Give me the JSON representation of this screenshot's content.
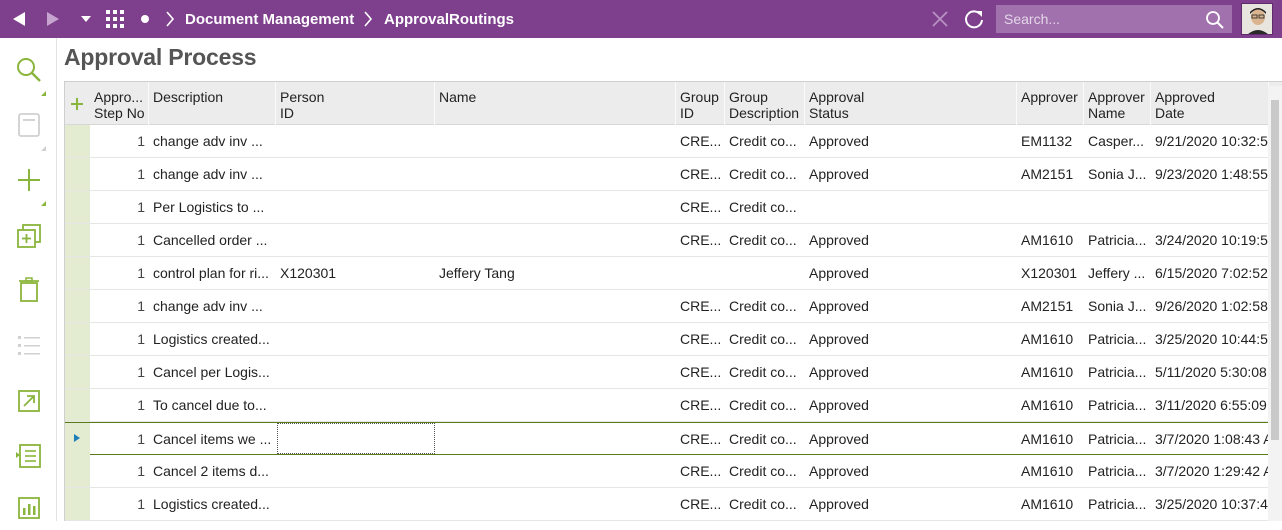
{
  "topbar": {
    "breadcrumbs": [
      "Document Management",
      "ApprovalRoutings"
    ],
    "search_placeholder": "Search...",
    "colors": {
      "bar": "#7e3f8d",
      "accent": "#8ab53c"
    }
  },
  "sidebar": {
    "icons": [
      "search-icon",
      "save-icon",
      "add-icon",
      "duplicate-icon",
      "delete-icon",
      "list-icon",
      "navigate-icon",
      "details-list-icon",
      "chart-icon"
    ]
  },
  "page": {
    "title": "Approval Process"
  },
  "grid": {
    "columns": [
      {
        "key": "step",
        "label_1": "Appro...",
        "label_2": "Step No"
      },
      {
        "key": "desc",
        "label_1": "Description",
        "label_2": ""
      },
      {
        "key": "person",
        "label_1": "Person",
        "label_2": "ID"
      },
      {
        "key": "name",
        "label_1": "Name",
        "label_2": ""
      },
      {
        "key": "group",
        "label_1": "Group",
        "label_2": "ID"
      },
      {
        "key": "gdesc",
        "label_1": "Group",
        "label_2": "Description"
      },
      {
        "key": "status",
        "label_1": "Approval",
        "label_2": "Status"
      },
      {
        "key": "approver",
        "label_1": "Approver",
        "label_2": ""
      },
      {
        "key": "aname",
        "label_1": "Approver",
        "label_2": "Name"
      },
      {
        "key": "adate",
        "label_1": "Approved",
        "label_2": "Date"
      }
    ],
    "rows": [
      {
        "step": "1",
        "desc": "change adv inv ...",
        "person": "",
        "name": "",
        "group": "CRE...",
        "gdesc": "Credit co...",
        "status": "Approved",
        "approver": "EM1132",
        "aname": "Casper...",
        "adate": "9/21/2020 10:32:5"
      },
      {
        "step": "1",
        "desc": "change adv inv ...",
        "person": "",
        "name": "",
        "group": "CRE...",
        "gdesc": "Credit co...",
        "status": "Approved",
        "approver": "AM2151",
        "aname": "Sonia J...",
        "adate": "9/23/2020 1:48:55"
      },
      {
        "step": "1",
        "desc": "Per Logistics to ...",
        "person": "",
        "name": "",
        "group": "CRE...",
        "gdesc": "Credit co...",
        "status": "",
        "approver": "",
        "aname": "",
        "adate": ""
      },
      {
        "step": "1",
        "desc": "Cancelled order ...",
        "person": "",
        "name": "",
        "group": "CRE...",
        "gdesc": "Credit co...",
        "status": "Approved",
        "approver": "AM1610",
        "aname": "Patricia...",
        "adate": "3/24/2020 10:19:5"
      },
      {
        "step": "1",
        "desc": "control plan for ri...",
        "person": "X120301",
        "name": "Jeffery Tang",
        "group": "",
        "gdesc": "",
        "status": "Approved",
        "approver": "X120301",
        "aname": "Jeffery ...",
        "adate": "6/15/2020 7:02:52"
      },
      {
        "step": "1",
        "desc": "change adv inv ...",
        "person": "",
        "name": "",
        "group": "CRE...",
        "gdesc": "Credit co...",
        "status": "Approved",
        "approver": "AM2151",
        "aname": "Sonia J...",
        "adate": "9/26/2020 1:02:58"
      },
      {
        "step": "1",
        "desc": "Logistics created...",
        "person": "",
        "name": "",
        "group": "CRE...",
        "gdesc": "Credit co...",
        "status": "Approved",
        "approver": "AM1610",
        "aname": "Patricia...",
        "adate": "3/25/2020 10:44:5"
      },
      {
        "step": "1",
        "desc": "Cancel per Logis...",
        "person": "",
        "name": "",
        "group": "CRE...",
        "gdesc": "Credit co...",
        "status": "Approved",
        "approver": "AM1610",
        "aname": "Patricia...",
        "adate": "5/11/2020 5:30:08"
      },
      {
        "step": "1",
        "desc": "To cancel due to...",
        "person": "",
        "name": "",
        "group": "CRE...",
        "gdesc": "Credit co...",
        "status": "Approved",
        "approver": "AM1610",
        "aname": "Patricia...",
        "adate": "3/11/2020 6:55:09"
      },
      {
        "step": "1",
        "desc": "Cancel items we ...",
        "person": "",
        "name": "",
        "group": "CRE...",
        "gdesc": "Credit co...",
        "status": "Approved",
        "approver": "AM1610",
        "aname": "Patricia...",
        "adate": "3/7/2020 1:08:43 A",
        "selected": true
      },
      {
        "step": "1",
        "desc": "Cancel 2 items d...",
        "person": "",
        "name": "",
        "group": "CRE...",
        "gdesc": "Credit co...",
        "status": "Approved",
        "approver": "AM1610",
        "aname": "Patricia...",
        "adate": "3/7/2020 1:29:42 A"
      },
      {
        "step": "1",
        "desc": "Logistics created...",
        "person": "",
        "name": "",
        "group": "CRE...",
        "gdesc": "Credit co...",
        "status": "Approved",
        "approver": "AM1610",
        "aname": "Patricia...",
        "adate": "3/25/2020 10:37:4"
      }
    ]
  }
}
